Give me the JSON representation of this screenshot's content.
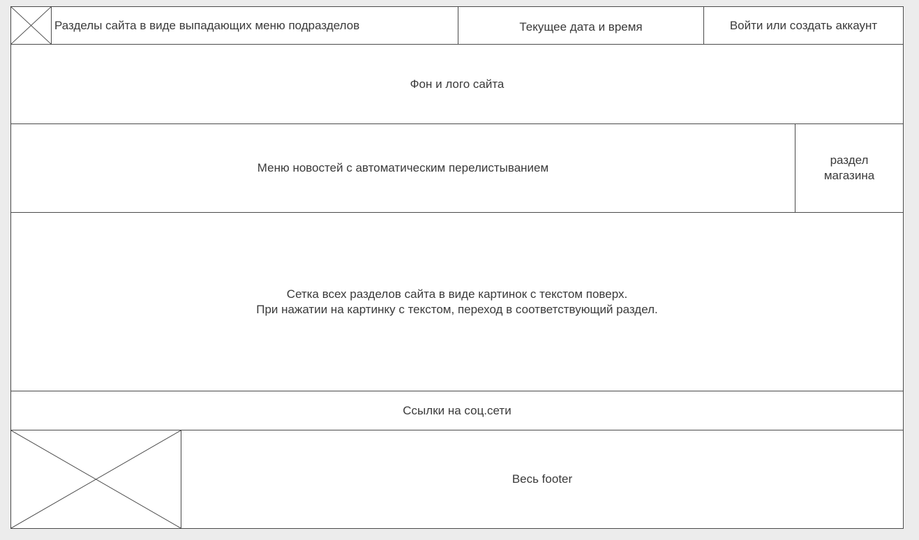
{
  "header": {
    "sections_menu": "Разделы сайта в виде выпадающих меню подразделов",
    "datetime": "Текущее дата и время",
    "login": "Войти или создать аккаунт"
  },
  "banner": {
    "label": "Фон и лого сайта"
  },
  "news": {
    "label": "Меню новостей с автоматическим перелистыванием",
    "shop_line1": "раздел",
    "shop_line2": "магазина"
  },
  "grid": {
    "line1": "Сетка всех разделов сайта в виде картинок с текстом поверх.",
    "line2": "При нажатии на картинку с текстом, переход в соответствующий раздел."
  },
  "social": {
    "label": "Ссылки на соц.сети"
  },
  "footer": {
    "label": "Весь footer"
  }
}
